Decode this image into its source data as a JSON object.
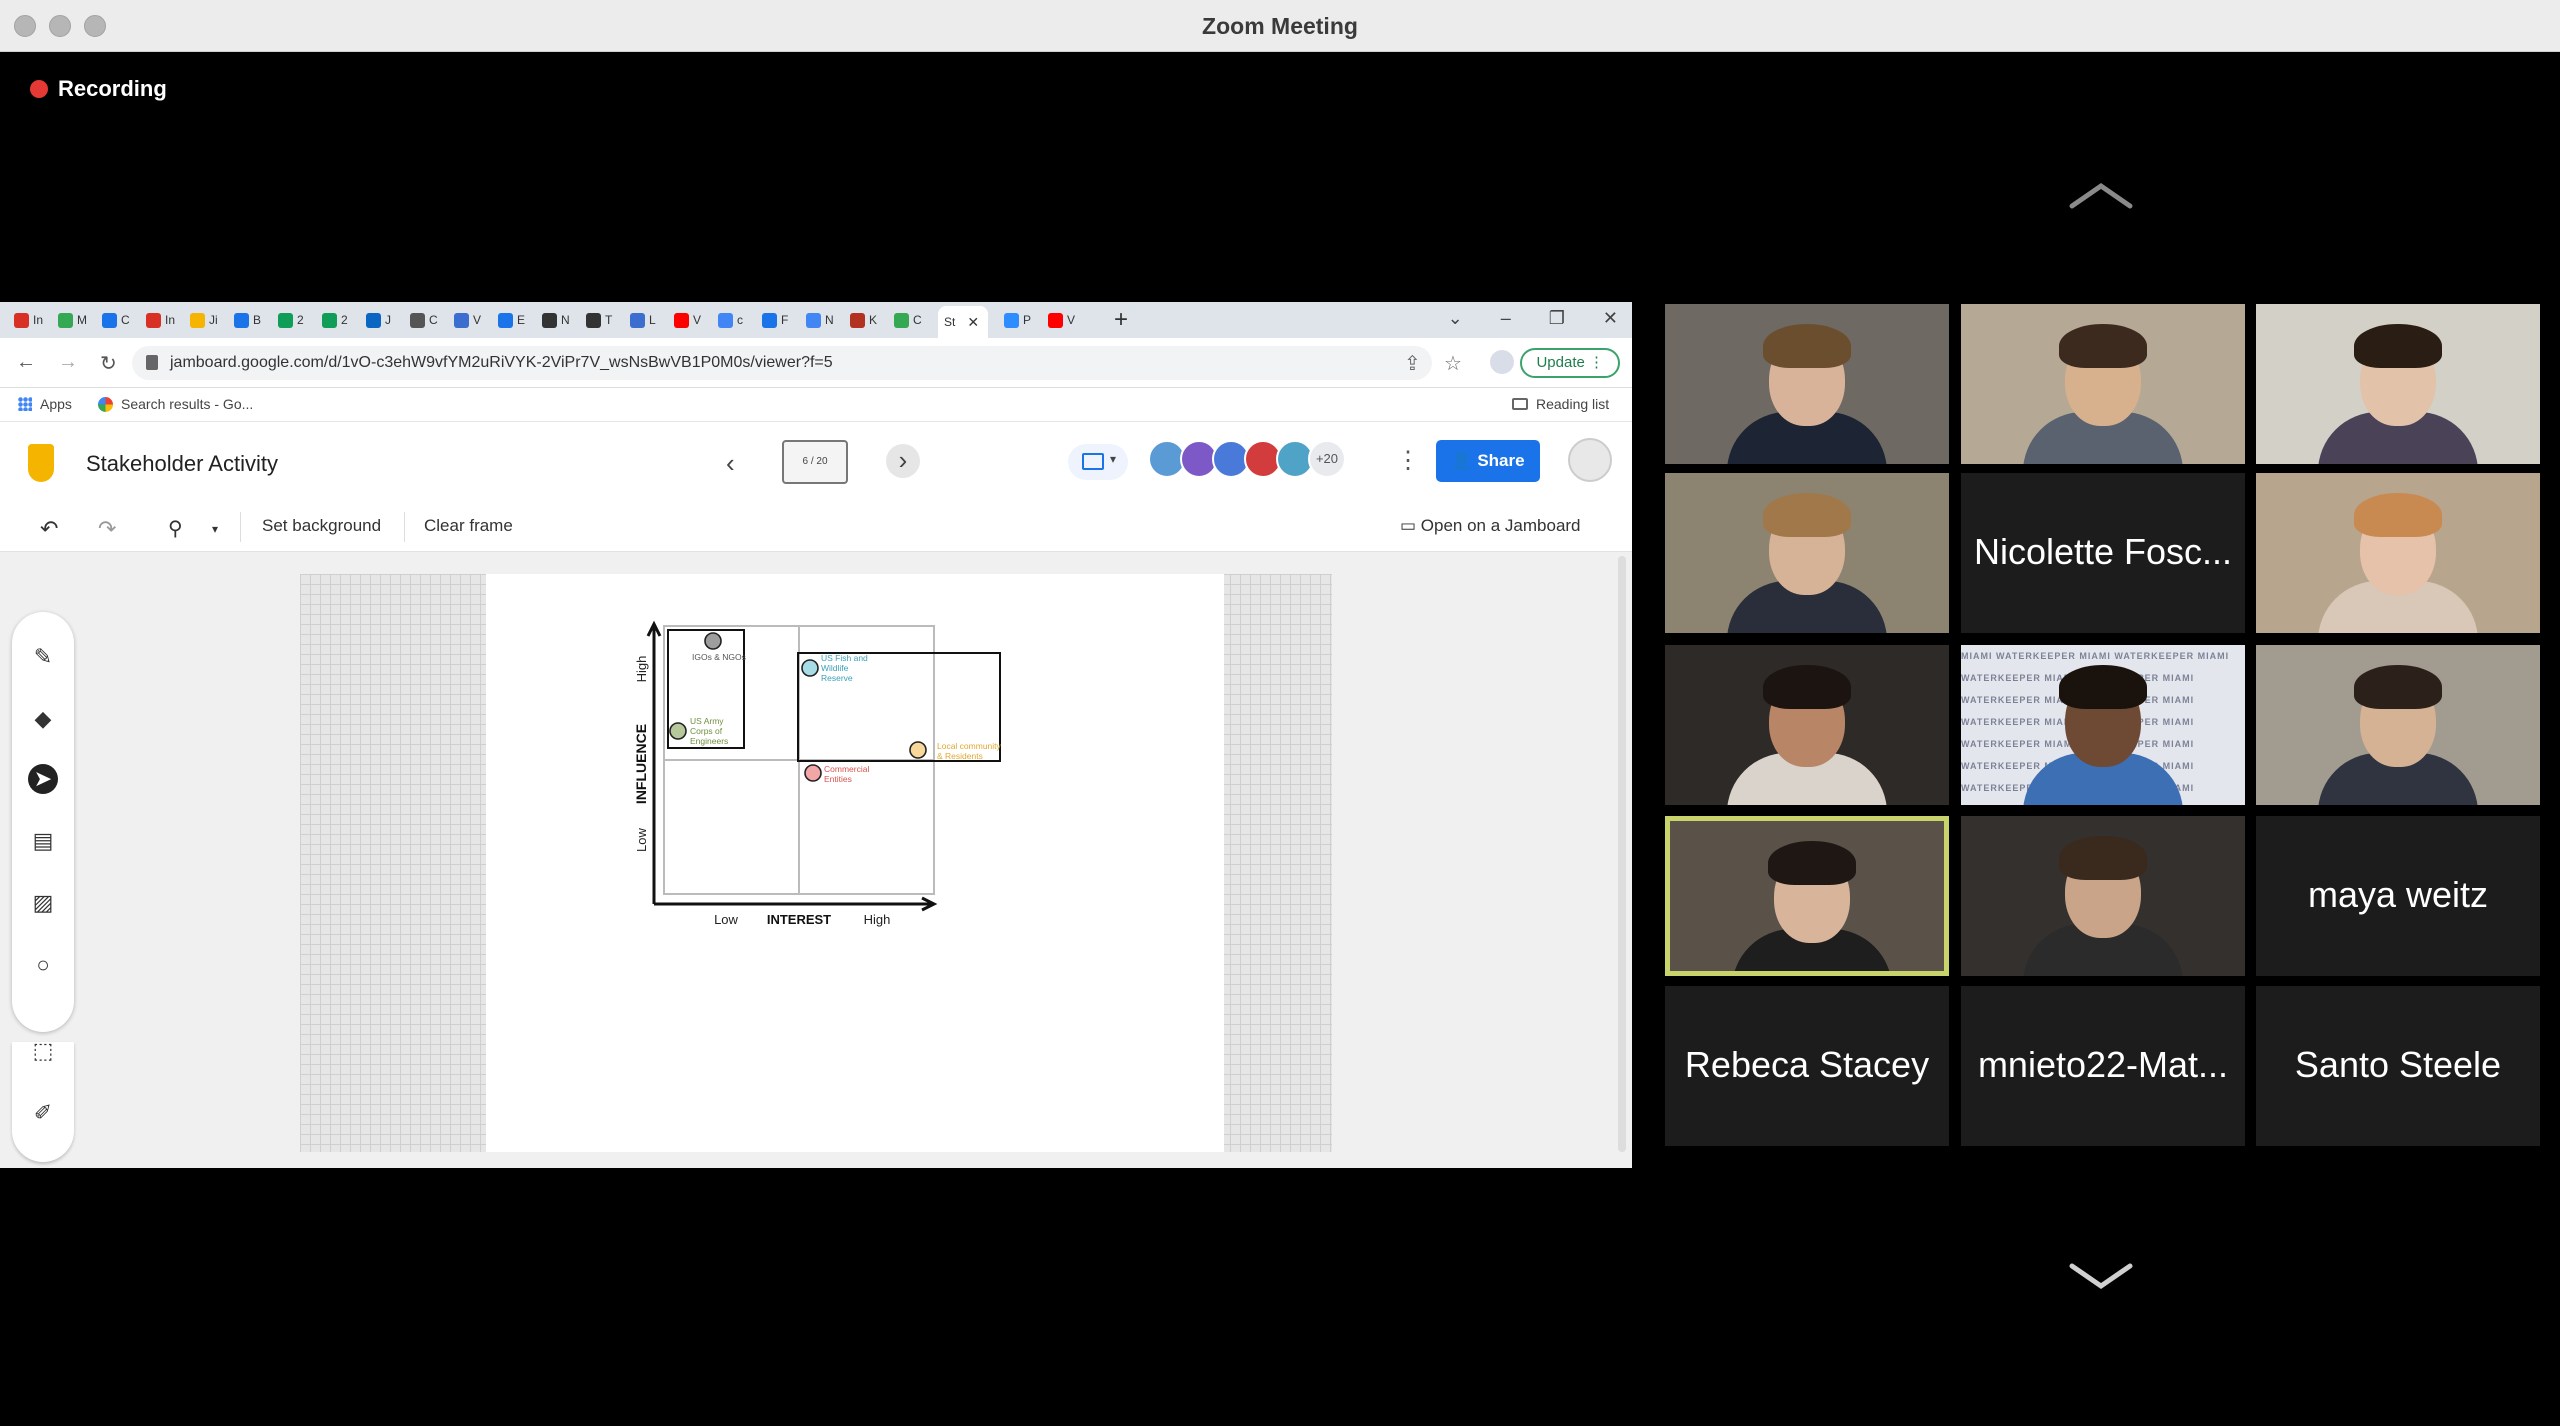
{
  "window": {
    "title": "Zoom Meeting",
    "recording_label": "Recording"
  },
  "browser": {
    "tabs": [
      {
        "letter": "M",
        "text": "In",
        "color": "#d93025"
      },
      {
        "letter": "",
        "text": "M",
        "color": "#34a853"
      },
      {
        "letter": "",
        "text": "C",
        "color": "#1a73e8"
      },
      {
        "letter": "M",
        "text": "In",
        "color": "#d93025"
      },
      {
        "letter": "",
        "text": "Ji",
        "color": "#f4b400"
      },
      {
        "letter": "",
        "text": "B",
        "color": "#1a73e8"
      },
      {
        "letter": "",
        "text": "2",
        "color": "#0f9d58"
      },
      {
        "letter": "",
        "text": "2",
        "color": "#0f9d58"
      },
      {
        "letter": "",
        "text": "J",
        "color": "#0a66c2"
      },
      {
        "letter": "",
        "text": "C",
        "color": "#555555"
      },
      {
        "letter": "",
        "text": "V",
        "color": "#3c6ecf"
      },
      {
        "letter": "",
        "text": "E",
        "color": "#1a73e8"
      },
      {
        "letter": "",
        "text": "N",
        "color": "#333333"
      },
      {
        "letter": "",
        "text": "T",
        "color": "#333333"
      },
      {
        "letter": "",
        "text": "L",
        "color": "#3c6ecf"
      },
      {
        "letter": "",
        "text": "V",
        "color": "#ff0000"
      },
      {
        "letter": "",
        "text": "c",
        "color": "#4285f4"
      },
      {
        "letter": "",
        "text": "F",
        "color": "#1a73e8"
      },
      {
        "letter": "",
        "text": "N",
        "color": "#4285f4"
      },
      {
        "letter": "",
        "text": "K",
        "color": "#b23121"
      },
      {
        "letter": "",
        "text": "C",
        "color": "#34a853"
      }
    ],
    "active_tab_text": "St",
    "after_tabs": [
      {
        "text": "P",
        "color": "#2d8cff"
      },
      {
        "text": "V",
        "color": "#ff0000"
      }
    ],
    "url": "jamboard.google.com/d/1vO-c3ehW9vfYM2uRiVYK-2ViPr7V_wsNsBwVB1P0M0s/viewer?f=5",
    "update_label": "Update",
    "bookmarks": {
      "apps": "Apps",
      "search": "Search results - Go...",
      "reading_list": "Reading list"
    }
  },
  "jamboard": {
    "title": "Stakeholder Activity",
    "frame_counter": "6 / 20",
    "extra_collaborators": "+20",
    "share_label": "Share",
    "toolbar": {
      "set_background": "Set background",
      "clear_frame": "Clear frame",
      "open_on_jamboard": "Open on a Jamboard"
    }
  },
  "chart": {
    "y_axis_label": "INFLUENCE",
    "y_high": "High",
    "y_low": "Low",
    "x_axis_label": "INTEREST",
    "x_low": "Low",
    "x_high": "High",
    "stakeholders": [
      {
        "label_lines": [
          "IGOs & NGOs"
        ],
        "color": "#9e9e9e",
        "text_color": "#555555"
      },
      {
        "label_lines": [
          "US Army",
          "Corps of",
          "Engineers"
        ],
        "color": "#b7c99b",
        "text_color": "#6f8f3c"
      },
      {
        "label_lines": [
          "US Fish and",
          "Wildlife",
          "Reserve"
        ],
        "color": "#a6dde6",
        "text_color": "#3aa0b8"
      },
      {
        "label_lines": [
          "Commercial",
          "Entities"
        ],
        "color": "#f2a7a7",
        "text_color": "#d9534f"
      },
      {
        "label_lines": [
          "Local community",
          "& Residents"
        ],
        "color": "#f7d79a",
        "text_color": "#e0a82e"
      }
    ]
  },
  "gallery": {
    "participants": [
      {
        "type": "video",
        "bg": "#6e6a63",
        "skin": "#d8b39a",
        "hair": "#6b4e2e",
        "shirt": "#1d2433"
      },
      {
        "type": "video",
        "bg": "#b5a996",
        "skin": "#d7b08e",
        "hair": "#3b2a1d",
        "shirt": "#5a6270"
      },
      {
        "type": "video",
        "bg": "#d3d0c8",
        "skin": "#e3c2aa",
        "hair": "#2a1d14",
        "shirt": "#4a4358"
      },
      {
        "type": "video",
        "bg": "#8c8470",
        "skin": "#d6b297",
        "hair": "#a1784a",
        "shirt": "#2a2d3a"
      },
      {
        "type": "name",
        "name": "Nicolette Fosc..."
      },
      {
        "type": "video",
        "bg": "#b7a58d",
        "skin": "#e6c2aa",
        "hair": "#c98a52",
        "shirt": "#d9c7b7"
      },
      {
        "type": "video",
        "bg": "#2e2a27",
        "skin": "#b88666",
        "hair": "#1b1410",
        "shirt": "#d9d3cc"
      },
      {
        "type": "video",
        "bg": "#e4e6ee",
        "skin": "#6e4a34",
        "hair": "#1a120c",
        "shirt": "#3c6fb3"
      },
      {
        "type": "video",
        "bg": "#a29c90",
        "skin": "#d5b293",
        "hair": "#2b211a",
        "shirt": "#2f3440"
      },
      {
        "type": "video",
        "bg": "#5a5149",
        "skin": "#d8b49a",
        "hair": "#1f1713",
        "shirt": "#1e1e1e"
      },
      {
        "type": "video",
        "bg": "#33302d",
        "skin": "#c9a488",
        "hair": "#3a2a1e",
        "shirt": "#2b2b2b"
      },
      {
        "type": "name",
        "name": "maya weitz"
      },
      {
        "type": "name",
        "name": "Rebeca Stacey"
      },
      {
        "type": "name",
        "name": "mnieto22-Mat..."
      },
      {
        "type": "name",
        "name": "Santo Steele"
      }
    ],
    "active_speaker_index": 9,
    "watermark_text": "MIAMI WATERKEEPER"
  },
  "colors": {
    "accent": "#1a73e8",
    "recording": "#e53935",
    "active_speaker": "#c8d36c"
  }
}
